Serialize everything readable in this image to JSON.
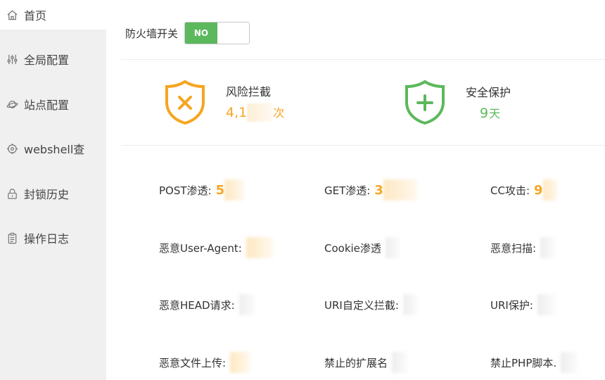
{
  "sidebar": {
    "items": [
      {
        "label": "首页",
        "icon": "home-icon",
        "active": true
      },
      {
        "label": "全局配置",
        "icon": "sliders-icon"
      },
      {
        "label": "站点配置",
        "icon": "planet-icon"
      },
      {
        "label": "webshell查",
        "icon": "target-icon"
      },
      {
        "label": "封锁历史",
        "icon": "lock-icon"
      },
      {
        "label": "操作日志",
        "icon": "clipboard-icon"
      }
    ]
  },
  "firewall": {
    "label": "防火墙开关",
    "toggle_text": "NO"
  },
  "stats": {
    "risk": {
      "title": "风险拦截",
      "value": "4,1",
      "unit": "次",
      "color": "#f6a521"
    },
    "safe": {
      "title": "安全保护",
      "value": "9",
      "unit": "天",
      "color": "#5cb85c"
    }
  },
  "items": [
    {
      "label": "POST渗透:",
      "value": "5"
    },
    {
      "label": "GET渗透:",
      "value": "3"
    },
    {
      "label": "CC攻击:",
      "value": "9"
    },
    {
      "label": "恶意User-Agent:",
      "value": ""
    },
    {
      "label": "Cookie渗透",
      "value": ""
    },
    {
      "label": "恶意扫描:",
      "value": ""
    },
    {
      "label": "恶意HEAD请求:",
      "value": ""
    },
    {
      "label": "URI自定义拦截:",
      "value": ""
    },
    {
      "label": "URI保护:",
      "value": ""
    },
    {
      "label": "恶意文件上传:",
      "value": ""
    },
    {
      "label": "禁止的扩展名",
      "value": ""
    },
    {
      "label": "禁止PHP脚本.",
      "value": ""
    }
  ]
}
